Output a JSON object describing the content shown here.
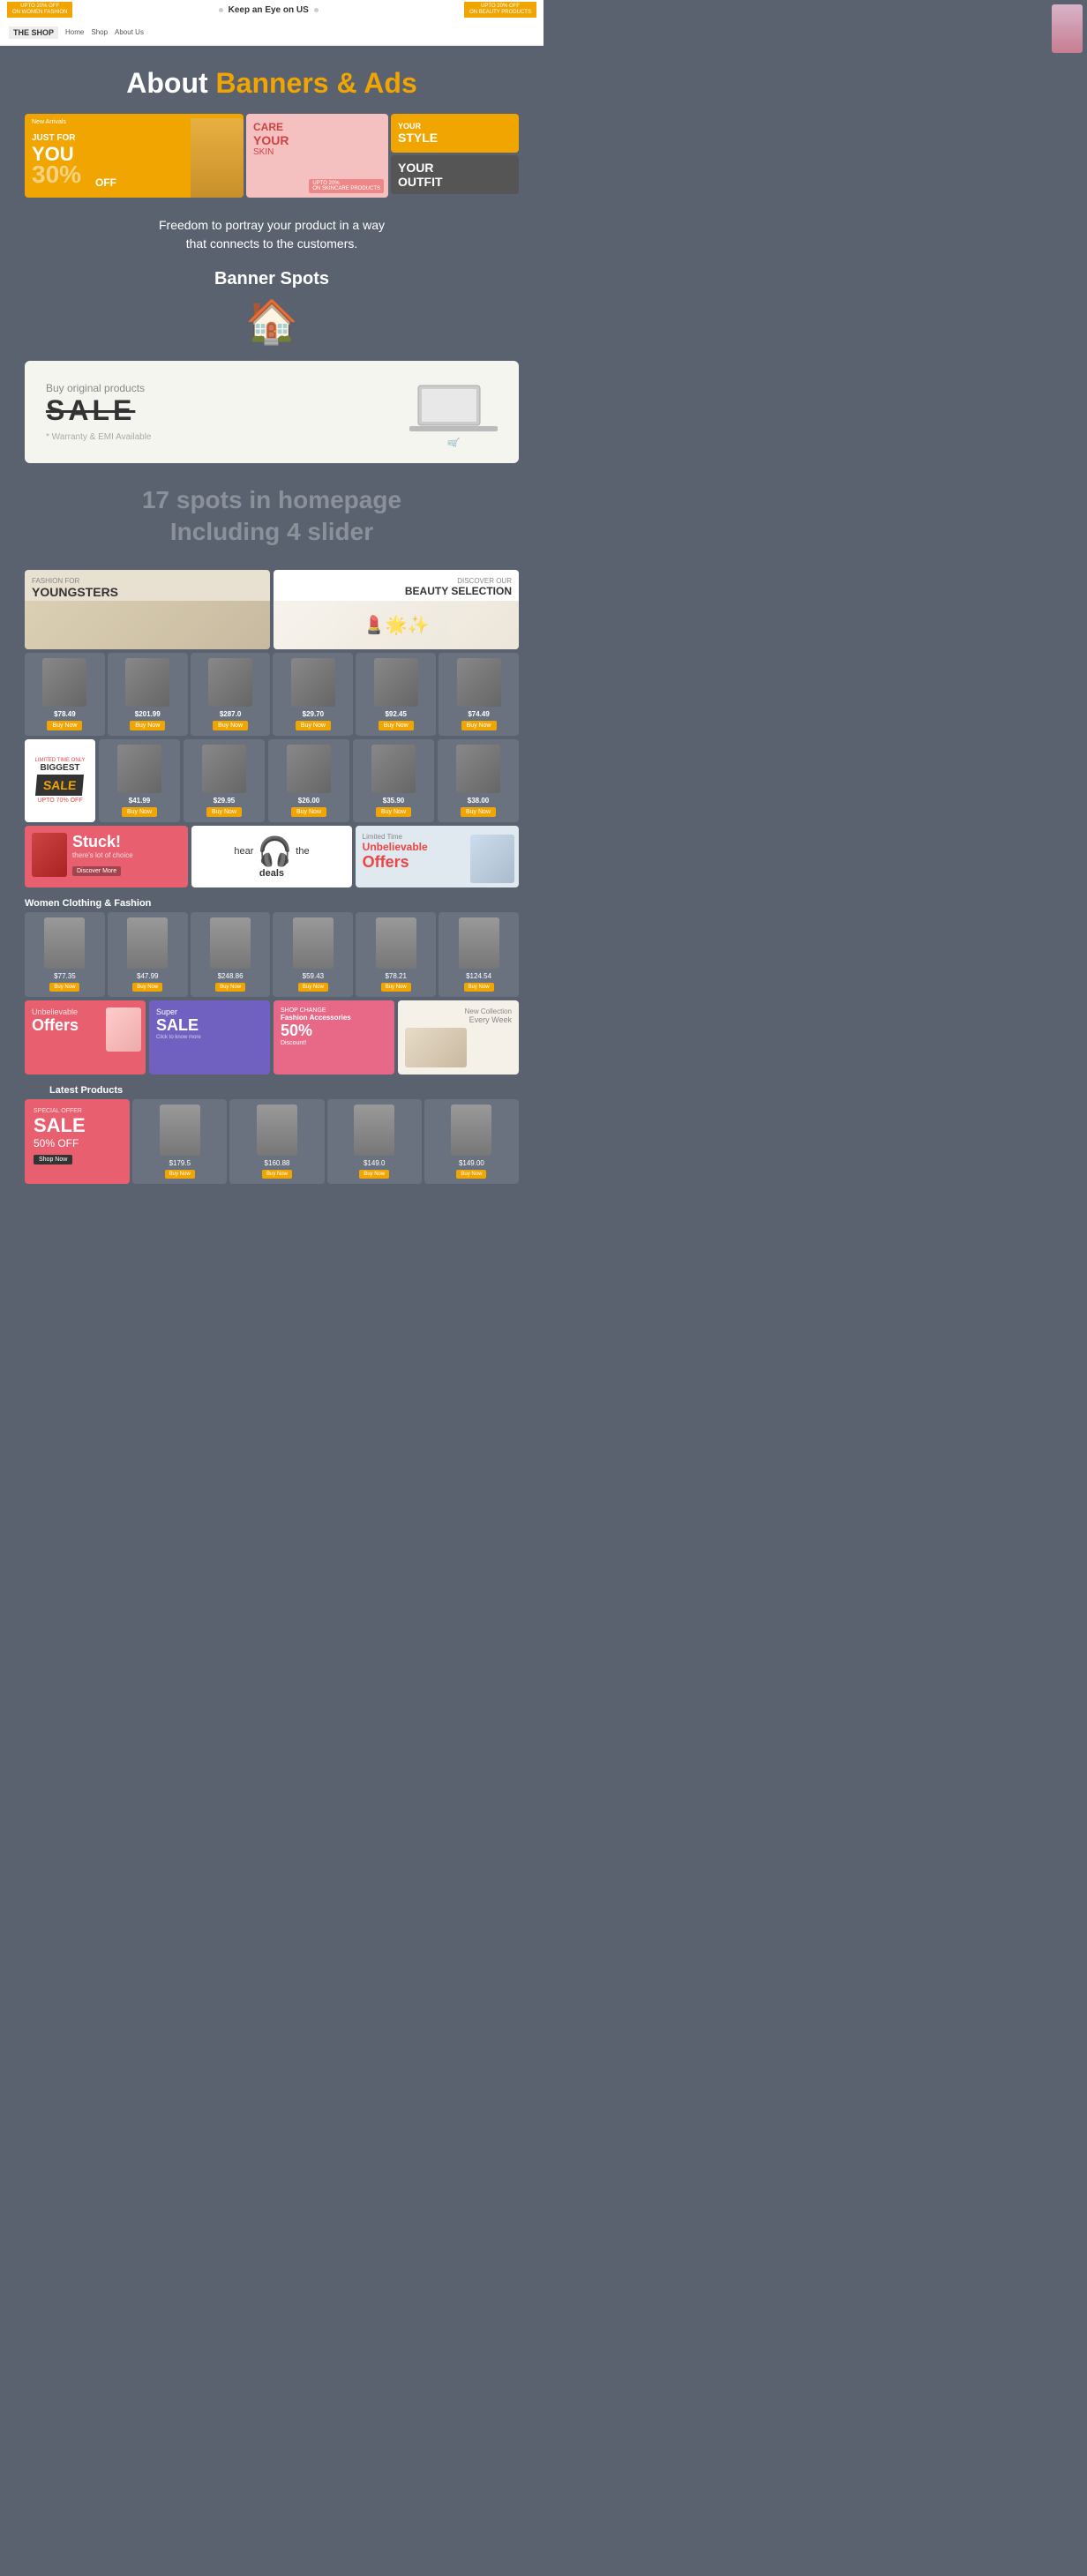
{
  "topbar": {
    "promo_left": "UPTO 20% OFF\nON WOMEN FASHION",
    "center": "Keep an Eye on US",
    "promo_right": "UPTO 20% OFF\nON BEAUTY PRODUCTS"
  },
  "nav": {
    "logo": "THE SHOP",
    "links": [
      "Home",
      "Shop",
      "About Us"
    ]
  },
  "hero": {
    "about": "About",
    "banners_ads": "Banners & Ads"
  },
  "banners_top": {
    "b1": {
      "new_arrivals": "New Arrivals",
      "just_for": "JUST FOR",
      "you": "YOU",
      "percent": "30%",
      "off": "OFF"
    },
    "b2": {
      "care": "CARE",
      "your": "YOUR",
      "skin": "SKIN",
      "upto": "UPTO 20%\nON SKINCARE PRODUCTS"
    },
    "b3": {
      "your_style": "YOUR",
      "style": "STYLE"
    },
    "b4": {
      "your_outfit": "YOUR\nOUTFIT"
    }
  },
  "subtext": {
    "line1": "Freedom to portray your product in a way",
    "line2": "that connects to the customers."
  },
  "banner_spots": {
    "title": "Banner Spots",
    "house_icon": "🏠"
  },
  "sale_section": {
    "buy_original": "Buy original products",
    "sale_text": "SALE",
    "warranty": "* Warranty & EMI Available"
  },
  "spots_info": {
    "line1": "17 spots in homepage",
    "line2": "Including 4 slider"
  },
  "two_col": {
    "youngsters": {
      "fashion_for": "FASHION FOR",
      "label": "YOUNGSTERS"
    },
    "beauty": {
      "discover_our": "DISCOVER OUR",
      "label": "BEAUTY SELECTION"
    }
  },
  "product_row1": {
    "items": [
      {
        "price": "$78.49",
        "btn": "Buy Now"
      },
      {
        "price": "$201.99",
        "btn": "Buy Now"
      },
      {
        "price": "$287.0",
        "btn": "Buy Now"
      },
      {
        "price": "$29.70",
        "btn": "Buy Now"
      },
      {
        "price": "$92.45",
        "btn": "Buy Now"
      },
      {
        "price": "$74.49",
        "btn": "Buy Now"
      }
    ]
  },
  "biggest_sale": {
    "limited": "LIMITED TIME ONLY",
    "biggest": "BIGGEST",
    "sale": "SALE",
    "upto": "UPTO 70% OFF"
  },
  "promo_row": {
    "stuck": {
      "title": "Stuck!",
      "subtitle": "there's lot of choice",
      "cta": "Discover More"
    },
    "deals": {
      "hear": "hear",
      "the": "the",
      "deals": "deals"
    },
    "limited": {
      "limited_time": "Limited Time",
      "unbelievable": "Unbelievable",
      "offers": "Offers"
    }
  },
  "women_section": {
    "title": "Women Clothing & Fashion",
    "items": [
      {
        "price": "$77.35",
        "btn": "Buy Now"
      },
      {
        "price": "$47.99",
        "btn": "Buy Now"
      },
      {
        "price": "$248.86",
        "btn": "Buy Now"
      },
      {
        "price": "$59.43",
        "btn": "Buy Now"
      },
      {
        "price": "$78.21",
        "btn": "Buy Now"
      },
      {
        "price": "$124.54",
        "btn": "Buy Now"
      }
    ]
  },
  "bottom_promos": {
    "unbelievable": {
      "label": "Unbelievable",
      "offers": "Offers"
    },
    "super_sale": {
      "super": "Super",
      "sale": "SALE",
      "click": "Click to know more"
    },
    "fashion": {
      "shop": "SHOP CHANGE",
      "acc": "Fashion Accessories",
      "percent": "50%",
      "discount": "Discount!"
    },
    "new_col": {
      "new": "New Collection",
      "every_week": "Every Week"
    }
  },
  "bottom_prod_row": {
    "items": [
      {
        "price": "$179.5",
        "btn": "Buy Now"
      },
      {
        "price": "$160.88",
        "btn": "Buy Now"
      },
      {
        "price": "$149.0",
        "btn": "Buy Now"
      }
    ]
  },
  "sale_final": {
    "special_offer": "SPECIAL OFFER",
    "sale": "SALE",
    "fifty": "50% OFF",
    "shop_now": "Shop Now"
  }
}
